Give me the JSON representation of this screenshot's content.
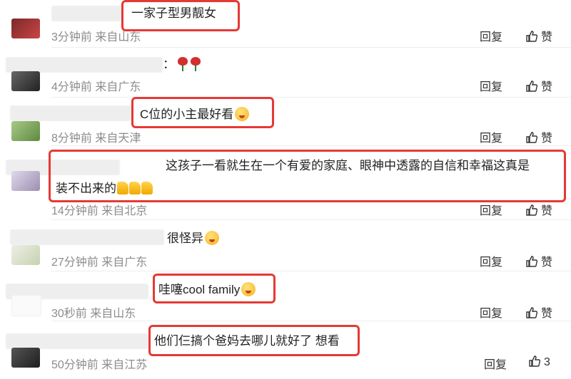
{
  "comments": [
    {
      "text": "一家子型男靓女",
      "time": "3分钟前",
      "location": "来自山东",
      "reply": "回复",
      "like": "赞",
      "emoji": "",
      "avatar_colors": [
        "#7a2a2a",
        "#c44"
      ]
    },
    {
      "text": "：",
      "time": "4分钟前",
      "location": "来自广东",
      "reply": "回复",
      "like": "赞",
      "emoji": "rose-rose",
      "avatar_colors": [
        "#555",
        "#333"
      ]
    },
    {
      "text": "C位的小主最好看",
      "time": "8分钟前",
      "location": "来自天津",
      "reply": "回复",
      "like": "赞",
      "emoji": "blush",
      "avatar_colors": [
        "#9fc37a",
        "#6a8f4a"
      ]
    },
    {
      "text_line1": "这孩子一看就生在一个有爱的家庭、眼神中透露的自信和幸福这真是",
      "text_line2": "装不出来的",
      "time": "14分钟前",
      "location": "来自北京",
      "reply": "回复",
      "like": "赞",
      "emoji": "thumbs-up-x3",
      "avatar_colors": [
        "#d8d0e0",
        "#a89ab8"
      ]
    },
    {
      "text": "很怪异",
      "time": "27分钟前",
      "location": "来自广东",
      "reply": "回复",
      "like": "赞",
      "emoji": "laugh-cry",
      "avatar_colors": [
        "#e8e8e0",
        "#c9d4b8"
      ]
    },
    {
      "text": "哇噻cool family",
      "time": "30秒前",
      "location": "来自山东",
      "reply": "回复",
      "like": "赞",
      "emoji": "kiss",
      "avatar_colors": [
        "#ffffff",
        "#f4f4f4"
      ]
    },
    {
      "text": "他们仨搞个爸妈去哪儿就好了 想看",
      "time": "50分钟前",
      "location": "来自江苏",
      "reply": "回复",
      "like": "3",
      "emoji": "",
      "avatar_colors": [
        "#444",
        "#222"
      ]
    }
  ],
  "highlight_color": "#e53935",
  "icons": {
    "like": "thumbs-up-icon",
    "rose": "rose-icon",
    "face": "emoji-face-icon"
  }
}
